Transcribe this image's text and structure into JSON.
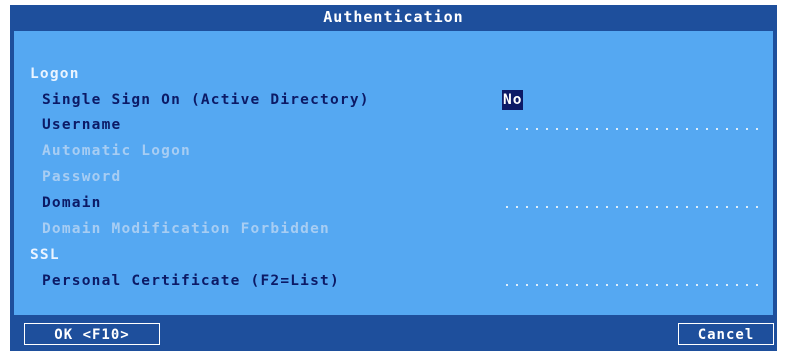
{
  "dialog": {
    "title": "Authentication"
  },
  "sections": {
    "logon": "Logon",
    "ssl": "SSL"
  },
  "fields": {
    "single_sign_on": {
      "label": "Single Sign On (Active Directory)",
      "value": "No"
    },
    "username": {
      "label": "Username"
    },
    "automatic_logon": {
      "label": "Automatic Logon"
    },
    "password": {
      "label": "Password"
    },
    "domain": {
      "label": "Domain"
    },
    "domain_modification_forbidden": {
      "label": "Domain Modification Forbidden"
    },
    "personal_certificate": {
      "label": "Personal Certificate (F2=List)"
    }
  },
  "buttons": {
    "ok": "OK <F10>",
    "cancel": "Cancel"
  },
  "colors": {
    "frame": "#1e4f9c",
    "content": "#55a8f2",
    "active_text": "#0c1a66",
    "disabled_text": "#a7cdf3"
  }
}
